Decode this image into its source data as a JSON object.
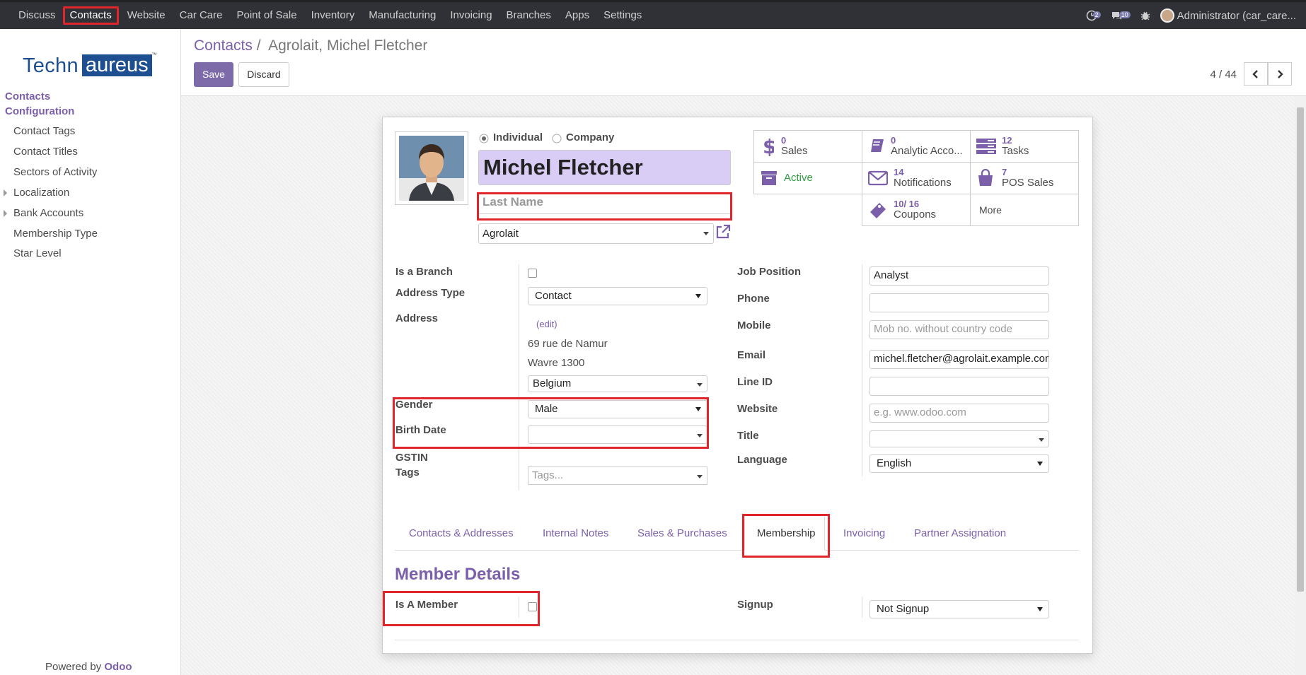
{
  "topbar": {
    "menu": [
      "Discuss",
      "Contacts",
      "Website",
      "Car Care",
      "Point of Sale",
      "Inventory",
      "Manufacturing",
      "Invoicing",
      "Branches",
      "Apps",
      "Settings"
    ],
    "active": "Contacts",
    "activity_count": "2",
    "message_count": "10",
    "user": "Administrator (car_care..."
  },
  "sidebar": {
    "logo_left": "Techn",
    "logo_right": "aureus",
    "logo_tm": "™",
    "heading1": "Contacts",
    "heading2": "Configuration",
    "items": [
      "Contact Tags",
      "Contact Titles",
      "Sectors of Activity",
      "Localization",
      "Bank Accounts",
      "Membership Type",
      "Star Level"
    ],
    "powered_prefix": "Powered by ",
    "powered_brand": "Odoo"
  },
  "control": {
    "breadcrumb_parent": "Contacts",
    "breadcrumb_sep": "/",
    "breadcrumb_current": "Agrolait, Michel Fletcher",
    "save": "Save",
    "discard": "Discard",
    "pager": "4 / 44"
  },
  "form": {
    "type_individual": "Individual",
    "type_company": "Company",
    "name": "Michel Fletcher",
    "last_name_placeholder": "Last Name",
    "company": "Agrolait",
    "stats": [
      {
        "num": "0",
        "label": "Sales",
        "icon": "dollar-icon"
      },
      {
        "num": "0",
        "label": "Analytic Acco...",
        "icon": "book-icon"
      },
      {
        "num": "12",
        "label": "Tasks",
        "icon": "tasks-icon"
      },
      {
        "num": "",
        "label": "Active",
        "icon": "archive-icon"
      },
      {
        "num": "14",
        "label": "Notifications",
        "icon": "envelope-icon"
      },
      {
        "num": "7",
        "label": "POS Sales",
        "icon": "shopping-bag-icon"
      },
      {
        "num": "10/ 16",
        "label": "Coupons",
        "icon": "ticket-icon"
      },
      {
        "num": "",
        "label": "More",
        "icon": ""
      }
    ],
    "labels": {
      "is_branch": "Is a Branch",
      "address_type": "Address Type",
      "address": "Address",
      "gender": "Gender",
      "birth_date": "Birth Date",
      "gstin": "GSTIN",
      "tags": "Tags",
      "job_position": "Job Position",
      "phone": "Phone",
      "mobile": "Mobile",
      "email": "Email",
      "line_id": "Line ID",
      "website": "Website",
      "title": "Title",
      "language": "Language"
    },
    "values": {
      "address_type": "Contact",
      "address_edit": "(edit)",
      "street": "69 rue de Namur",
      "city_zip": "Wavre 1300",
      "country": "Belgium",
      "gender": "Male",
      "birth_date": "",
      "tags_placeholder": "Tags...",
      "job_position": "Analyst",
      "phone": "",
      "mobile_placeholder": "Mob no. without country code",
      "email": "michel.fletcher@agrolait.example.com",
      "line_id": "",
      "website_placeholder": "e.g. www.odoo.com",
      "title": "",
      "language": "English"
    },
    "tabs": [
      "Contacts & Addresses",
      "Internal Notes",
      "Sales & Purchases",
      "Membership",
      "Invoicing",
      "Partner Assignation"
    ],
    "active_tab": "Membership",
    "membership": {
      "heading": "Member Details",
      "is_member_label": "Is A Member",
      "signup_label": "Signup",
      "signup_value": "Not Signup"
    }
  },
  "colors": {
    "accent": "#7c5fab",
    "highlight": "#e0262b",
    "name_bg": "#d9ccf5",
    "topbar": "#2f3136",
    "active_green": "#2e9e3f"
  }
}
